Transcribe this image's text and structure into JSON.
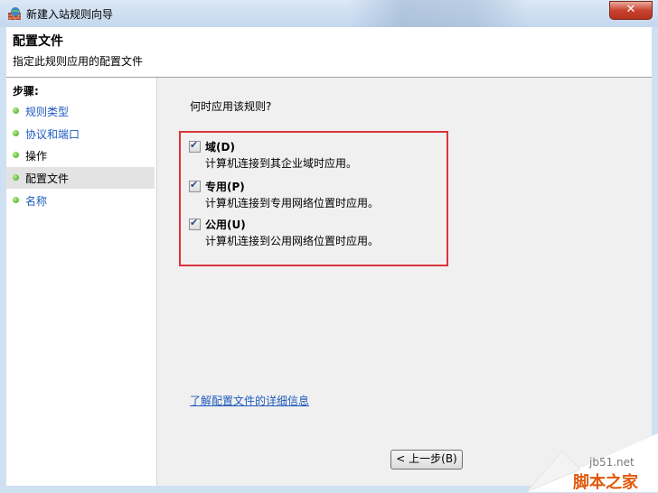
{
  "window": {
    "title": "新建入站规则向导",
    "close_glyph": "✕"
  },
  "header": {
    "title": "配置文件",
    "subtitle": "指定此规则应用的配置文件"
  },
  "sidebar": {
    "steps_label": "步骤:",
    "items": [
      {
        "label": "规则类型",
        "state": "link"
      },
      {
        "label": "协议和端口",
        "state": "link"
      },
      {
        "label": "操作",
        "state": "normal"
      },
      {
        "label": "配置文件",
        "state": "current"
      },
      {
        "label": "名称",
        "state": "link"
      }
    ]
  },
  "main": {
    "question": "何时应用该规则?",
    "options": [
      {
        "label": "域(D)",
        "description": "计算机连接到其企业域时应用。",
        "checked": true
      },
      {
        "label": "专用(P)",
        "description": "计算机连接到专用网络位置时应用。",
        "checked": true
      },
      {
        "label": "公用(U)",
        "description": "计算机连接到公用网络位置时应用。",
        "checked": true
      }
    ],
    "info_link": "了解配置文件的详细信息",
    "back_button": "< 上一步(B)"
  },
  "watermark": {
    "url": "jb51.net",
    "name": "脚本之家"
  },
  "colors": {
    "link": "#1e5bbd",
    "highlight_box": "#d9343a",
    "watermark": "#e05a0e"
  }
}
